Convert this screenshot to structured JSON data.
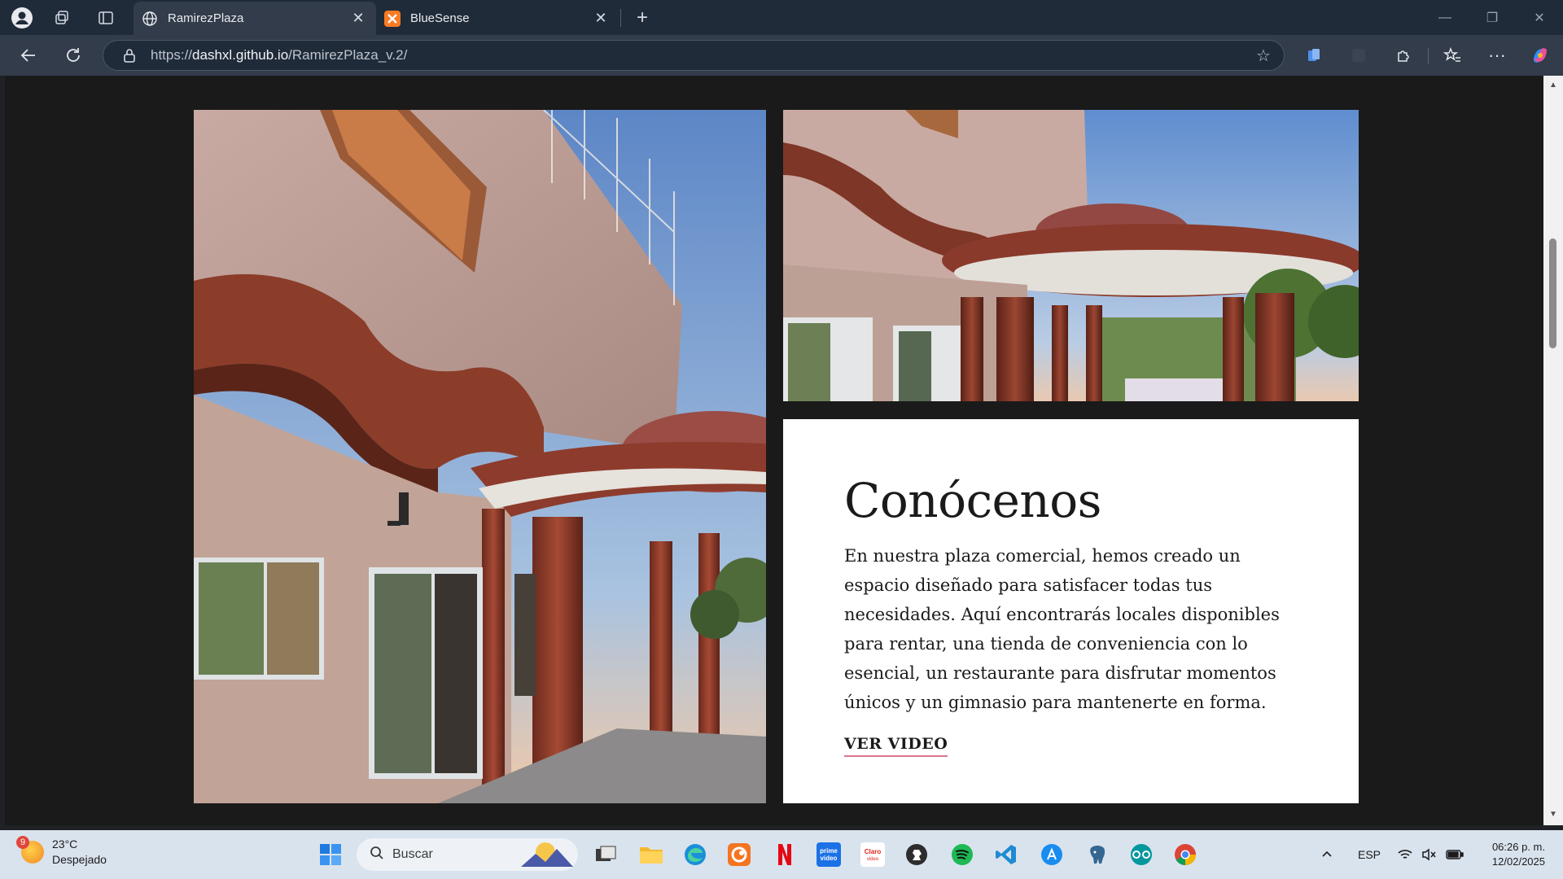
{
  "browser": {
    "tabs": [
      {
        "title": "RamirezPlaza",
        "active": true,
        "favicon": "globe-icon"
      },
      {
        "title": "BlueSense",
        "active": false,
        "favicon": "xampp-icon"
      }
    ],
    "url_prefix": "https://",
    "url_host": "dashxl.github.io",
    "url_path": "/RamirezPlaza_v.2/"
  },
  "page": {
    "about": {
      "title": "Conócenos",
      "body": "En nuestra plaza comercial, hemos creado un espacio diseñado para satisfacer todas tus necesidades. Aquí encontrarás locales disponibles para rentar, una tienda de conveniencia con lo esencial, un restaurante para disfrutar momentos únicos y un gimnasio para mantenerte en forma.",
      "link": "VER VIDEO"
    },
    "colors": {
      "page_bg": "#1a1a1a",
      "card_bg": "#ffffff",
      "link_underline": "#d9788c"
    }
  },
  "taskbar": {
    "weather": {
      "temp": "23°C",
      "condition": "Despejado",
      "badge": "9"
    },
    "search_placeholder": "Buscar",
    "language": "ESP",
    "time": "06:26 p. m.",
    "date": "12/02/2025",
    "apps": [
      "windows-start-icon",
      "search-icon",
      "task-view-icon",
      "file-explorer-icon",
      "edge-icon",
      "crunchyroll-icon",
      "netflix-icon",
      "prime-video-icon",
      "claro-video-icon",
      "chess-icon",
      "spotify-icon",
      "vscode-icon",
      "app-store-icon",
      "postgres-icon",
      "arduino-icon",
      "chrome-icon"
    ]
  }
}
